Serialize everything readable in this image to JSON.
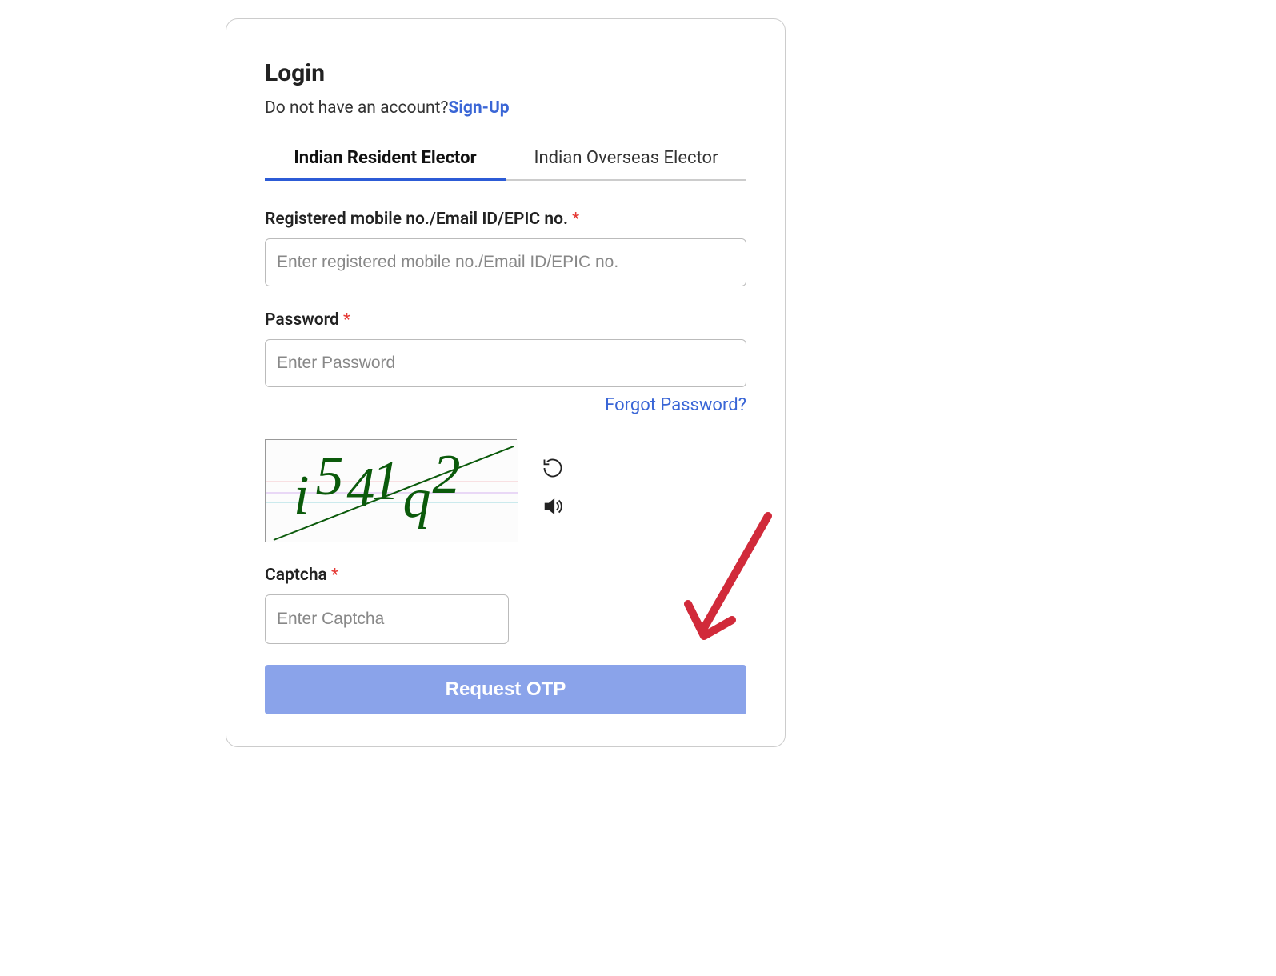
{
  "login": {
    "title": "Login",
    "signup_prompt": "Do not have an account?",
    "signup_link": "Sign-Up",
    "tabs": {
      "resident": "Indian Resident Elector",
      "overseas": "Indian Overseas Elector"
    },
    "fields": {
      "username_label": "Registered mobile no./Email ID/EPIC no. ",
      "username_placeholder": "Enter registered mobile no./Email ID/EPIC no.",
      "password_label": "Password ",
      "password_placeholder": "Enter Password",
      "captcha_label": "Captcha ",
      "captcha_placeholder": "Enter Captcha"
    },
    "forgot_password": "Forgot Password?",
    "captcha_value": "i541q2",
    "submit_label": "Request OTP",
    "required_mark": "*"
  }
}
